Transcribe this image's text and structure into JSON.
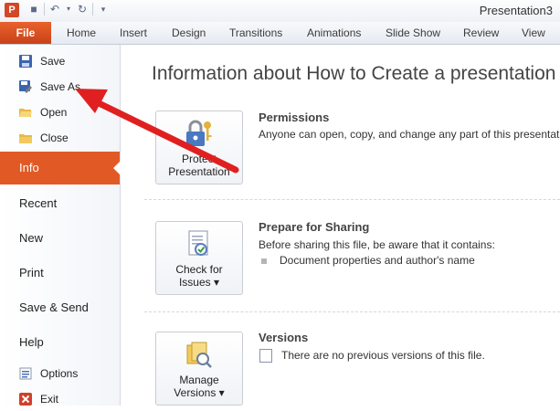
{
  "window": {
    "title": "Presentation3"
  },
  "ribbon": {
    "file_tab": "File",
    "tabs": [
      "Home",
      "Insert",
      "Design",
      "Transitions",
      "Animations",
      "Slide Show",
      "Review",
      "View"
    ]
  },
  "backstage": {
    "commands_top": [
      {
        "label": "Save",
        "icon": "save-icon"
      },
      {
        "label": "Save As",
        "icon": "save-as-icon"
      },
      {
        "label": "Open",
        "icon": "open-folder-icon"
      },
      {
        "label": "Close",
        "icon": "close-folder-icon"
      }
    ],
    "nav_tabs": [
      "Info",
      "Recent",
      "New",
      "Print",
      "Save & Send",
      "Help"
    ],
    "active_tab": "Info",
    "commands_bottom": [
      {
        "label": "Options",
        "icon": "options-icon"
      },
      {
        "label": "Exit",
        "icon": "exit-icon"
      }
    ]
  },
  "info": {
    "heading": "Information about How to Create a presentation",
    "sections": [
      {
        "button_label_line1": "Protect",
        "button_label_line2": "Presentation",
        "title": "Permissions",
        "text": "Anyone can open, copy, and change any part of this presentation."
      },
      {
        "button_label_line1": "Check for",
        "button_label_line2": "Issues ▾",
        "title": "Prepare for Sharing",
        "text": "Before sharing this file, be aware that it contains:",
        "bullet": "Document properties and author's name"
      },
      {
        "button_label_line1": "Manage",
        "button_label_line2": "Versions ▾",
        "title": "Versions",
        "text": "There are no previous versions of this file."
      }
    ]
  },
  "colors": {
    "accent": "#e15a25",
    "arrow": "#e02020"
  }
}
